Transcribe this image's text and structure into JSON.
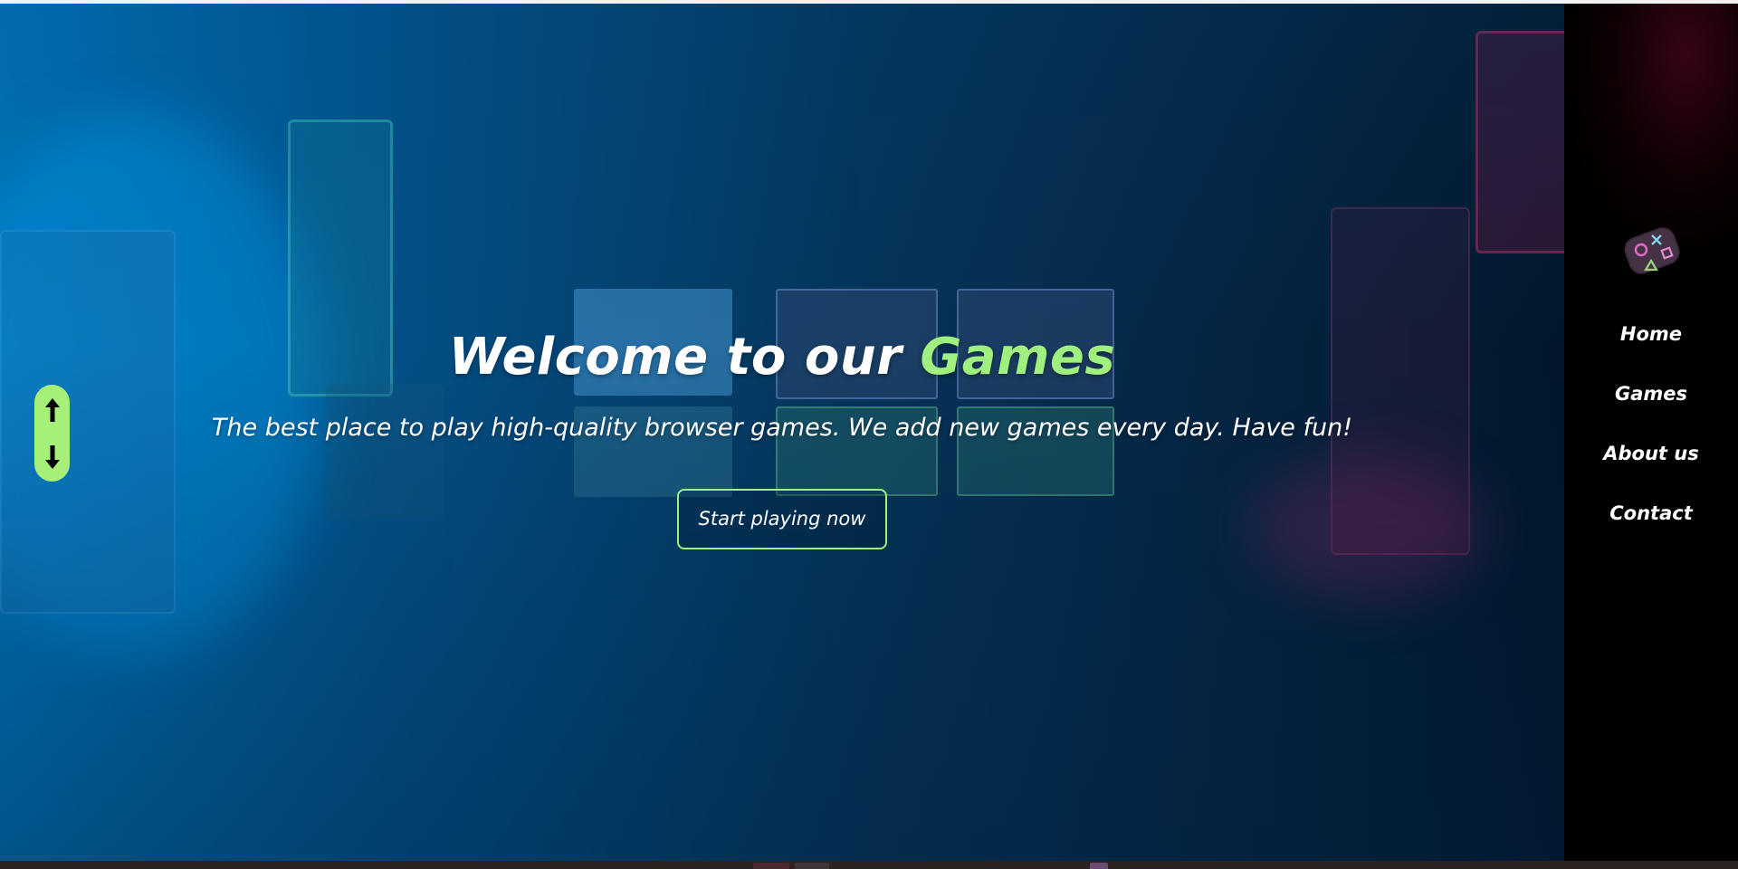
{
  "hero": {
    "title_main": "Welcome to our ",
    "title_accent": "Games",
    "subtitle": "The best place to play high-quality browser games. We add new games every day. Have fun!",
    "cta_label": "Start playing now"
  },
  "nav": {
    "logo_icon": "gamepad-buttons-icon",
    "items": [
      {
        "label": "Home"
      },
      {
        "label": "Games"
      },
      {
        "label": "About us"
      },
      {
        "label": "Contact"
      }
    ]
  },
  "scroll": {
    "up_icon": "arrow-up-icon",
    "down_icon": "arrow-down-icon"
  },
  "colors": {
    "accent": "#9ff07e",
    "hero_overlay": "#0078be",
    "sidebar": "#000000",
    "text": "#ffffff"
  }
}
